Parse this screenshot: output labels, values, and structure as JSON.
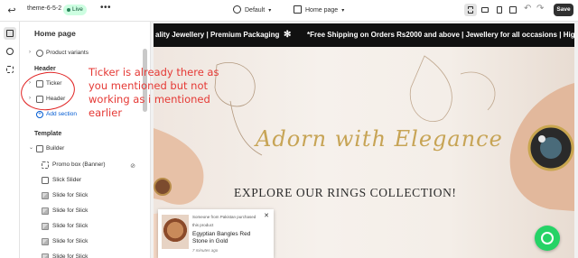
{
  "topbar": {
    "exit_icon": "exit-icon",
    "theme_name": "theme-6-5-2",
    "status_badge": "Live",
    "more_label": "•••",
    "template_select": "Default",
    "page_select": "Home page",
    "save_label": "Save"
  },
  "rail": {
    "items": [
      "sections-icon",
      "theme-settings-icon",
      "app-embeds-icon"
    ]
  },
  "sidebar": {
    "title": "Home page",
    "items": [
      {
        "label": "Product variants"
      },
      {
        "label": "Header"
      },
      {
        "label": "Ticker"
      },
      {
        "label": "Header"
      },
      {
        "label": "Add section"
      },
      {
        "label": "Template"
      },
      {
        "label": "Builder"
      },
      {
        "label": "Promo box (Banner)"
      },
      {
        "label": "Slick Slider"
      },
      {
        "label": "Slide for Slick"
      },
      {
        "label": "Slide for Slick"
      },
      {
        "label": "Slide for Slick"
      },
      {
        "label": "Slide for Slick"
      },
      {
        "label": "Slide for Slick"
      }
    ]
  },
  "annotation": {
    "lines": [
      "Ticker is already there as",
      "you mentioned but not",
      "working as i mentioned",
      "earlier"
    ],
    "color": "#e53935"
  },
  "preview": {
    "ticker_left": "ality Jewellery | Premium Packaging",
    "ticker_sep": "✻",
    "ticker_right": "*Free Shipping on Orders Rs2000 and above | Jewellery for all occasions | High Q",
    "hero_script": "Adorn with Elegance",
    "hero_sub": "EXPLORE OUR RINGS COLLECTION!",
    "popup": {
      "line1": "Someone from Pakistan purchased",
      "line2": "this product",
      "product_line1": "Egyptian Bangles Red",
      "product_line2": "Stone in Gold",
      "time": "7 minutes ago",
      "close": "✕"
    },
    "whatsapp_icon": "whatsapp-icon"
  }
}
